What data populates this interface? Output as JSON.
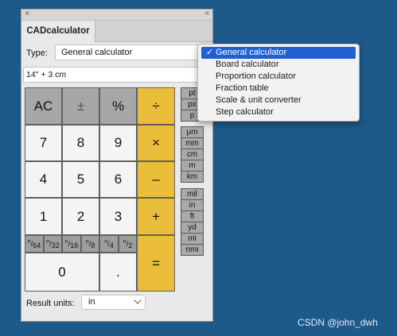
{
  "window": {
    "tab_title": "CADcalculator",
    "close_glyph": "×",
    "collapse_glyph": "‹‹"
  },
  "type_selector": {
    "label": "Type:",
    "value": "General calculator"
  },
  "expression": "14\" + 3 cm",
  "keypad": {
    "clear": "AC",
    "sign": "±",
    "percent": "%",
    "divide": "÷",
    "multiply": "×",
    "subtract": "–",
    "add": "+",
    "equals": "=",
    "seven": "7",
    "eight": "8",
    "nine": "9",
    "four": "4",
    "five": "5",
    "six": "6",
    "one": "1",
    "two": "2",
    "three": "3",
    "zero": "0",
    "decimal": ".",
    "fractions": [
      "64",
      "32",
      "16",
      "8",
      "4",
      "2"
    ],
    "fraction_numerator": "n"
  },
  "unit_buttons": {
    "typographic": [
      "pt",
      "px",
      "p"
    ],
    "metric": [
      "μm",
      "mm",
      "cm",
      "m",
      "km"
    ],
    "imperial": [
      "mil",
      "in",
      "ft",
      "yd",
      "mi",
      "nmi"
    ]
  },
  "result_units": {
    "label": "Result units:",
    "value": "in"
  },
  "type_menu": {
    "check_glyph": "✓",
    "items": [
      "General calculator",
      "Board calculator",
      "Proportion calculator",
      "Fraction table",
      "Scale & unit converter",
      "Step calculator"
    ],
    "selected_index": 0
  },
  "watermark": "CSDN @john_dwh",
  "colors": {
    "background": "#1d5989",
    "operator_keys": "#eabd3a",
    "gray_keys": "#a7a7a7",
    "menu_highlight": "#1f61d3"
  }
}
